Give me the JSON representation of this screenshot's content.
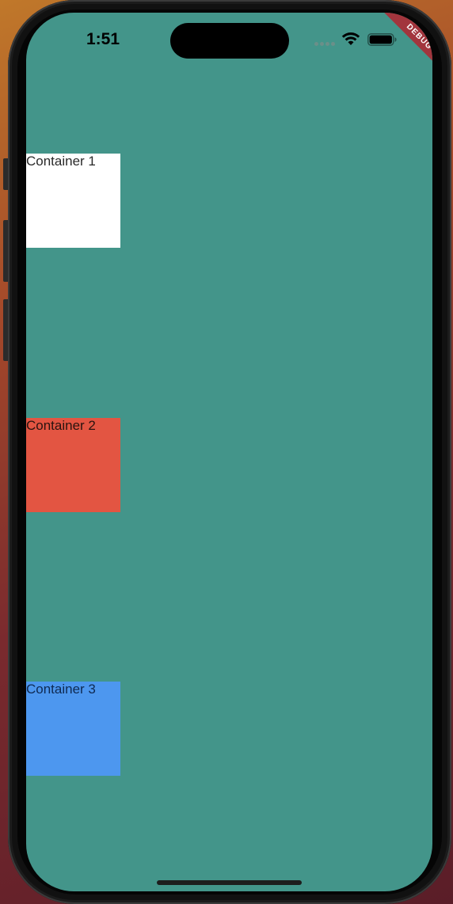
{
  "status_bar": {
    "time": "1:51"
  },
  "debug_banner": {
    "label": "DEBUG"
  },
  "containers": [
    {
      "label": "Container 1",
      "color": "#ffffff",
      "text_color": "#2a2a2a"
    },
    {
      "label": "Container 2",
      "color": "#e35542",
      "text_color": "#2a1410"
    },
    {
      "label": "Container 3",
      "color": "#4d97ef",
      "text_color": "#0f2a52"
    }
  ],
  "colors": {
    "screen_background": "#43958a",
    "home_indicator": "#1d1d1d",
    "debug_ribbon": "#a2353d"
  },
  "icons": {
    "signal": "cellular-signal-icon",
    "wifi": "wifi-icon",
    "battery": "battery-icon"
  }
}
